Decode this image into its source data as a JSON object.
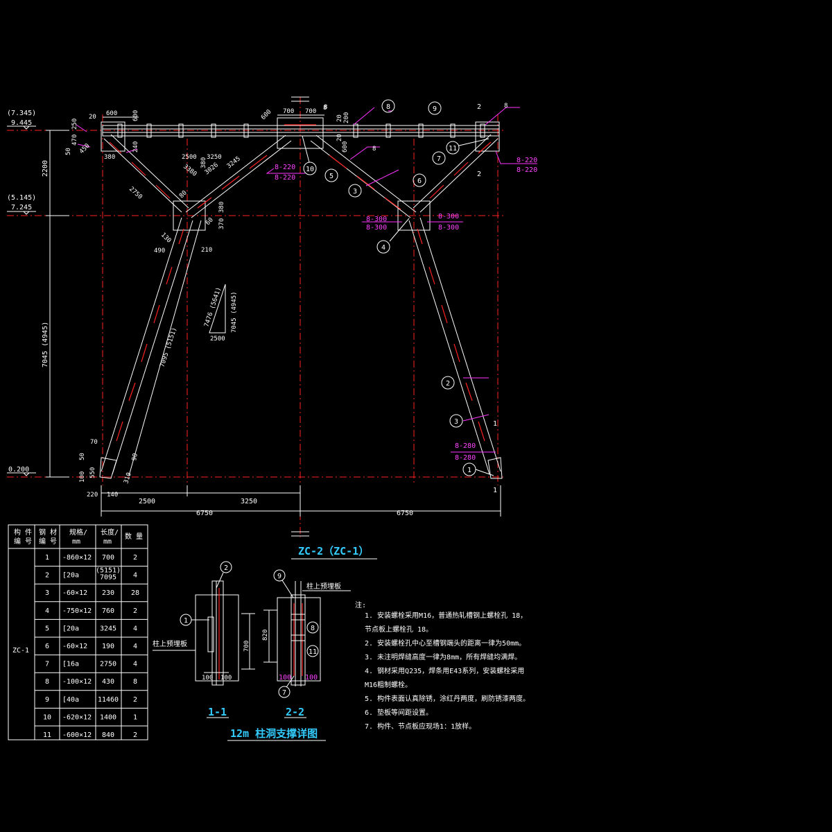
{
  "drawing_title": "12m 柱洞支撑详图",
  "main_view": {
    "title": "ZC-2（ZC-1）",
    "elevations": [
      {
        "upper": "(7.345)",
        "lower": "9.445"
      },
      {
        "upper": "(5.145)",
        "lower": "7.245"
      },
      {
        "upper": "",
        "lower": "0.200"
      }
    ],
    "vertical_dims": [
      "2200",
      "7045 (4945)"
    ],
    "left_top_dims": [
      "250",
      "470",
      "50",
      "450",
      "20",
      "600",
      "600",
      "240",
      "380"
    ],
    "top_dims": [
      "600",
      "700",
      "700",
      "8",
      "20",
      "200",
      "20",
      "600"
    ],
    "upper_diag_dims": [
      "2500",
      "3250",
      "3245",
      "3380",
      "3026",
      "380"
    ],
    "node_dims": [
      "2750",
      "80",
      "380",
      "370",
      "130",
      "60",
      "490",
      "210"
    ],
    "lower_diag_dims": [
      "7095 (5151)"
    ],
    "triangle_dims": [
      "7476 (5641)",
      "7045 (4945)",
      "2500"
    ],
    "bottom_dims": [
      "70",
      "50",
      "100",
      "550",
      "90",
      "310",
      "220",
      "140"
    ],
    "horizontal_dims": [
      "2500",
      "3250",
      "6750",
      "6750"
    ],
    "weld_labels": [
      "8-220",
      "8-220",
      "8-220",
      "8-220",
      "8-300",
      "8-300",
      "8-300",
      "8-300",
      "8-280",
      "8-280"
    ],
    "weld_sizes": [
      "8",
      "8",
      "8"
    ],
    "section_marks": [
      "2",
      "2",
      "1",
      "1"
    ],
    "balloons": [
      "1",
      "2",
      "3",
      "3",
      "4",
      "5",
      "6",
      "7",
      "8",
      "9",
      "10",
      "11"
    ]
  },
  "table": {
    "headers": [
      "构 件\n编 号",
      "钢 材\n编 号",
      "规格/\nmm",
      "长度/\nmm",
      "数 量"
    ],
    "member_id": "ZC-1",
    "rows": [
      {
        "no": "1",
        "spec": "-860×12",
        "len": "700",
        "qty": "2"
      },
      {
        "no": "2",
        "spec": "[20a",
        "len": "(5151)\n7095",
        "qty": "4"
      },
      {
        "no": "3",
        "spec": "-60×12",
        "len": "230",
        "qty": "28"
      },
      {
        "no": "4",
        "spec": "-750×12",
        "len": "760",
        "qty": "2"
      },
      {
        "no": "5",
        "spec": "[20a",
        "len": "3245",
        "qty": "4"
      },
      {
        "no": "6",
        "spec": "-60×12",
        "len": "190",
        "qty": "4"
      },
      {
        "no": "7",
        "spec": "[16a",
        "len": "2750",
        "qty": "4"
      },
      {
        "no": "8",
        "spec": "-100×12",
        "len": "430",
        "qty": "8"
      },
      {
        "no": "9",
        "spec": "[40a",
        "len": "11460",
        "qty": "2"
      },
      {
        "no": "10",
        "spec": "-620×12",
        "len": "1400",
        "qty": "1"
      },
      {
        "no": "11",
        "spec": "-600×12",
        "len": "840",
        "qty": "2"
      }
    ]
  },
  "section_11": {
    "title": "1-1",
    "label": "柱上预埋板",
    "dims": [
      "700",
      "100",
      "100"
    ],
    "balloons": [
      "1",
      "2"
    ]
  },
  "section_22": {
    "title": "2-2",
    "label": "柱上预埋板",
    "dims": [
      "820",
      "100",
      "100"
    ],
    "balloons": [
      "9",
      "8",
      "11",
      "7"
    ]
  },
  "notes": {
    "heading": "注:",
    "items": [
      "1. 安装螺栓采用M16，普通热轧槽钢上螺栓孔    18，",
      "   节点板上螺栓孔    18。",
      "2. 安装螺栓孔中心至槽钢端头的距离一律为50mm。",
      "3. 未注明焊缝高度一律为8mm，所有焊缝均满焊。",
      "4. 钢材采用Q235，焊条用E43系列，安装螺栓采用",
      "   M16粗制螺栓。",
      "5. 构件表面认真除锈，涂红丹两度，刷防锈漆两度。",
      "6. 垫板等间距设置。",
      "7. 构件、节点板应现场1：1放样。"
    ]
  }
}
